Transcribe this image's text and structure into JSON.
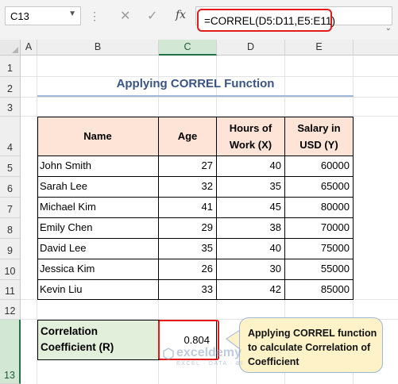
{
  "formula_bar": {
    "name_box": "C13",
    "formula": "=CORREL(D5:D11,E5:E11)"
  },
  "columns": [
    "A",
    "B",
    "C",
    "D",
    "E"
  ],
  "rows": [
    "1",
    "2",
    "3",
    "4",
    "5",
    "6",
    "7",
    "8",
    "9",
    "10",
    "11",
    "12",
    "13"
  ],
  "sheet": {
    "title": "Applying CORREL Function",
    "headers": {
      "name": "Name",
      "age": "Age",
      "hours": "Hours of Work (X)",
      "salary": "Salary in USD (Y)"
    },
    "data": [
      {
        "name": "John Smith",
        "age": "27",
        "hours": "40",
        "salary": "60000"
      },
      {
        "name": "Sarah Lee",
        "age": "32",
        "hours": "35",
        "salary": "65000"
      },
      {
        "name": "Michael Kim",
        "age": "41",
        "hours": "45",
        "salary": "80000"
      },
      {
        "name": "Emily Chen",
        "age": "29",
        "hours": "38",
        "salary": "70000"
      },
      {
        "name": "David Lee",
        "age": "35",
        "hours": "40",
        "salary": "75000"
      },
      {
        "name": "Jessica Kim",
        "age": "26",
        "hours": "30",
        "salary": "55000"
      },
      {
        "name": "Kevin Liu",
        "age": "33",
        "hours": "42",
        "salary": "85000"
      }
    ],
    "correlation_label": "Correlation Coefficient (R)",
    "correlation_value": "0.804",
    "callout": "Applying CORREL function to calculate Correlation of Coefficient"
  },
  "watermark": {
    "name": "exceldemy",
    "tagline": "EXCEL · DATA · BI"
  },
  "colors": {
    "header_fill": "#fde4d6",
    "result_fill": "#e1efdb",
    "callout_fill": "#fdf2c8",
    "highlight": "#e21b1b",
    "title_color": "#3a5582"
  },
  "icons": [
    "cancel-icon",
    "enter-icon",
    "function-icon",
    "dropdown-icon"
  ]
}
